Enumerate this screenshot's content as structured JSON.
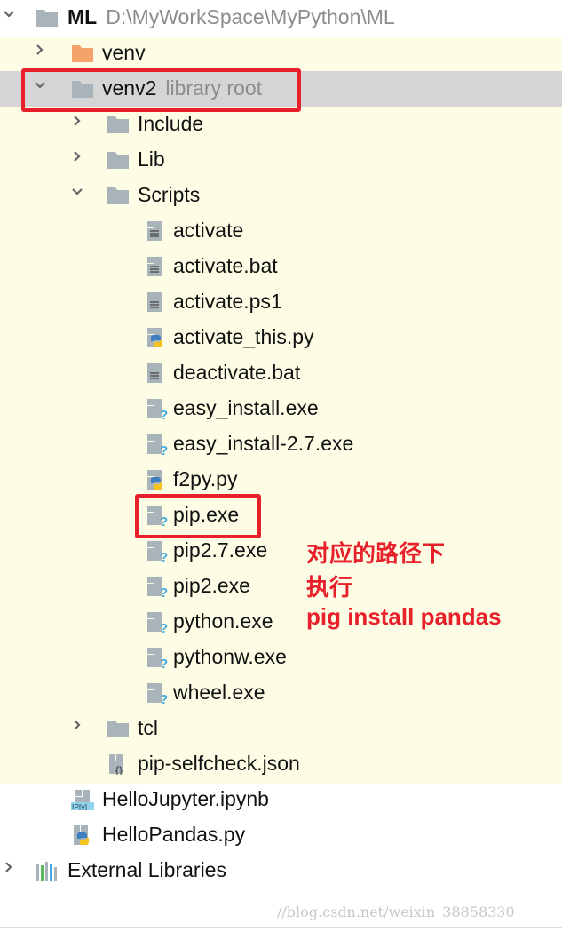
{
  "tree": [
    {
      "label": "ML",
      "hint": "D:\\MyWorkSpace\\MyPython\\ML",
      "level": 0,
      "arrow": "down",
      "icon": "folder",
      "bold": true
    },
    {
      "label": "venv",
      "level": 1,
      "arrow": "right",
      "icon": "folder-orange"
    },
    {
      "label": "venv2",
      "hint": "library root",
      "level": 1,
      "arrow": "down",
      "icon": "folder",
      "selected": true
    },
    {
      "label": "Include",
      "level": 2,
      "arrow": "right",
      "icon": "folder"
    },
    {
      "label": "Lib",
      "level": 2,
      "arrow": "right",
      "icon": "folder"
    },
    {
      "label": "Scripts",
      "level": 2,
      "arrow": "down",
      "icon": "folder"
    },
    {
      "label": "activate",
      "level": 3,
      "icon": "text-file"
    },
    {
      "label": "activate.bat",
      "level": 3,
      "icon": "text-file"
    },
    {
      "label": "activate.ps1",
      "level": 3,
      "icon": "text-file"
    },
    {
      "label": "activate_this.py",
      "level": 3,
      "icon": "python-file"
    },
    {
      "label": "deactivate.bat",
      "level": 3,
      "icon": "text-file"
    },
    {
      "label": "easy_install.exe",
      "level": 3,
      "icon": "unknown-file"
    },
    {
      "label": "easy_install-2.7.exe",
      "level": 3,
      "icon": "unknown-file"
    },
    {
      "label": "f2py.py",
      "level": 3,
      "icon": "python-file"
    },
    {
      "label": "pip.exe",
      "level": 3,
      "icon": "unknown-file"
    },
    {
      "label": "pip2.7.exe",
      "level": 3,
      "icon": "unknown-file"
    },
    {
      "label": "pip2.exe",
      "level": 3,
      "icon": "unknown-file"
    },
    {
      "label": "python.exe",
      "level": 3,
      "icon": "unknown-file"
    },
    {
      "label": "pythonw.exe",
      "level": 3,
      "icon": "unknown-file"
    },
    {
      "label": "wheel.exe",
      "level": 3,
      "icon": "unknown-file"
    },
    {
      "label": "tcl",
      "level": 2,
      "arrow": "right",
      "icon": "folder"
    },
    {
      "label": "pip-selfcheck.json",
      "level": 2,
      "icon": "json-file"
    },
    {
      "label": "HelloJupyter.ipynb",
      "level": 1,
      "icon": "ipynb-file"
    },
    {
      "label": "HelloPandas.py",
      "level": 1,
      "icon": "python-file"
    },
    {
      "label": "External Libraries",
      "level": 0,
      "arrow": "right",
      "icon": "libraries"
    }
  ],
  "annotation": {
    "lines": [
      "对应的路径下",
      "执行",
      "pig install pandas"
    ],
    "color": "#e8202a"
  },
  "watermark": "//blog.csdn.net/weixin_38858330",
  "colors": {
    "highlight_bg": "#fdfde6",
    "selected_bg": "#d5d5d5",
    "folder": "#a9b3ba",
    "folder_orange": "#f4a36b"
  }
}
